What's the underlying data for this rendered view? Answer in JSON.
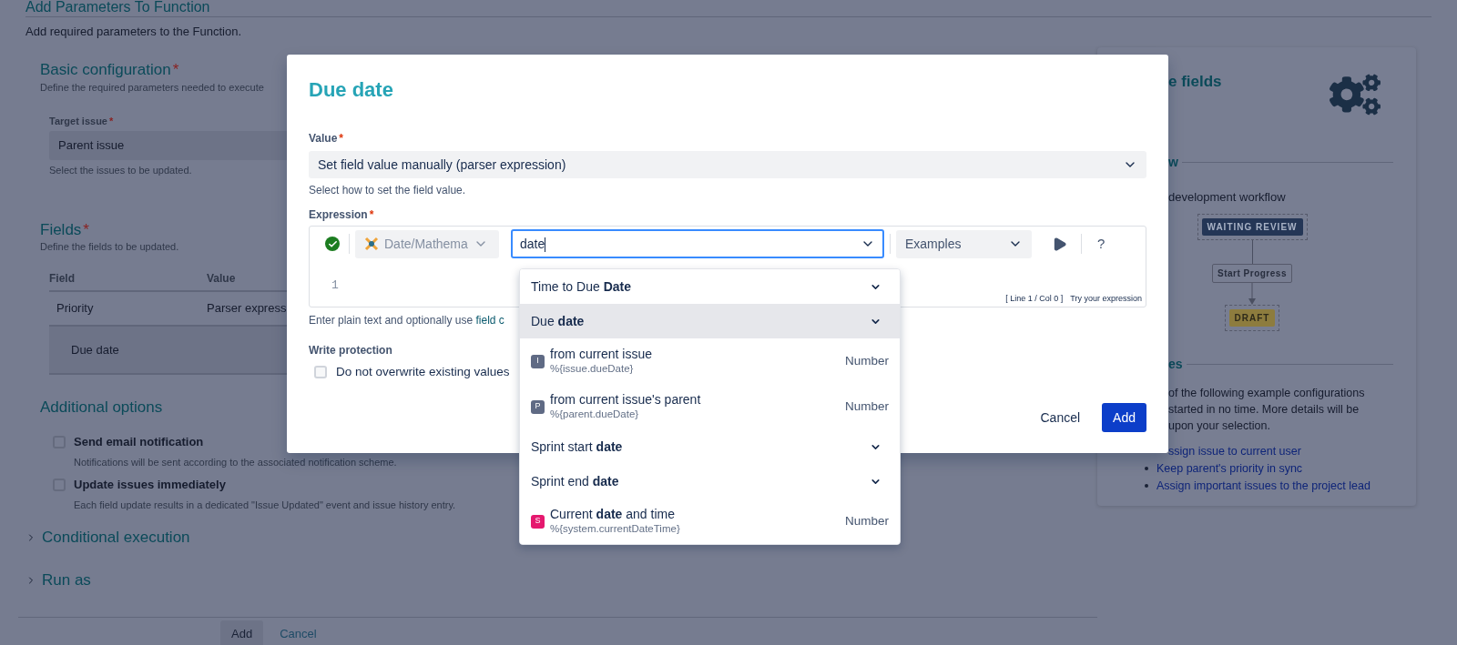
{
  "page": {
    "title": "Add Parameters To Function",
    "description": "Add required parameters to the Function."
  },
  "basic_configuration": {
    "title": "Basic configuration",
    "marker": "*",
    "description": "Define the required parameters needed to execute",
    "target_issue": {
      "label": "Target issue",
      "marker": "*",
      "value": "Parent issue",
      "hint": "Select the issues to be updated."
    }
  },
  "fields": {
    "title": "Fields",
    "marker": "*",
    "description": "Define the fields to be updated.",
    "columns": [
      "Field",
      "Value"
    ],
    "rows": [
      {
        "field": "Priority",
        "value": "Parser express",
        "selected": false
      },
      {
        "field": "Due date",
        "value": "",
        "selected": true
      }
    ]
  },
  "additional_options": {
    "title": "Additional options",
    "options": [
      {
        "label": "Send email notification",
        "description": "Notifications will be sent according to the associated notification scheme.",
        "checked": false
      },
      {
        "label": "Update issues immediately",
        "description": "Each field update results in a dedicated \"Issue Updated\" event and issue history entry.",
        "checked": false
      }
    ]
  },
  "collapsed_sections": [
    {
      "title": "Conditional execution",
      "expanded": false
    },
    {
      "title": "Run as",
      "expanded": false
    }
  ],
  "footer_buttons": [
    {
      "label": "Add",
      "kind": "primary"
    },
    {
      "label": "Cancel",
      "kind": "secondary"
    }
  ],
  "side_panel": {
    "title": "e fields",
    "workflow_heading": "w",
    "workflow_text": "development workflow",
    "workflow": {
      "from": "WAITING REVIEW",
      "transition": "Start Progress",
      "to": "DRAFT"
    },
    "examples_heading": "es",
    "examples_text": [
      "of the following example configurations",
      "started in no time. More details will be",
      "upon your selection."
    ],
    "links": [
      {
        "label": "ssign issue to current user",
        "bullet": false
      },
      {
        "label": "Keep parent's priority in sync",
        "bullet": true
      },
      {
        "label": "Assign important issues to the project lead",
        "bullet": true
      }
    ]
  },
  "dialog": {
    "title": "Due date",
    "value": {
      "label": "Value",
      "marker": "*",
      "selection": "Set field value manually (parser expression)",
      "hint": "Select how to set the field value."
    },
    "expression": {
      "label": "Expression",
      "marker": "*",
      "valid": true,
      "parser": "Date/Mathema",
      "query": "date",
      "examples": "Examples",
      "help": "?",
      "line_number": "1",
      "cursor": "[ Line 1 / Col 0 ]",
      "try_link": "Try your expression",
      "hint": "Enter plain text and optionally use",
      "hint_link": "field c"
    },
    "write_protection": {
      "label": "Write protection",
      "option": "Do not overwrite existing values",
      "checked": false
    },
    "buttons": [
      {
        "label": "Cancel",
        "kind": "secondary"
      },
      {
        "label": "Add",
        "kind": "primary"
      }
    ]
  },
  "suggestions": [
    {
      "kind": "group",
      "label": "Time to Due **Date**",
      "selected": false
    },
    {
      "kind": "group",
      "label": "Due **date**",
      "selected": true
    },
    {
      "kind": "field",
      "badge": "I",
      "color": "#5f6a84",
      "label": "from current issue",
      "code": "%{issue.dueDate}",
      "type": "Number",
      "selected": false
    },
    {
      "kind": "field",
      "badge": "P",
      "color": "#5f6a84",
      "label": "from current issue's parent",
      "code": "%{parent.dueDate}",
      "type": "Number",
      "selected": false
    },
    {
      "kind": "group",
      "label": "Sprint start **date**",
      "selected": false
    },
    {
      "kind": "group",
      "label": "Sprint end **date**",
      "selected": false
    },
    {
      "kind": "field",
      "badge": "S",
      "color": "#e5186e",
      "label": "Current **date** and time",
      "code": "%{system.currentDateTime}",
      "type": "Number",
      "selected": false
    }
  ]
}
